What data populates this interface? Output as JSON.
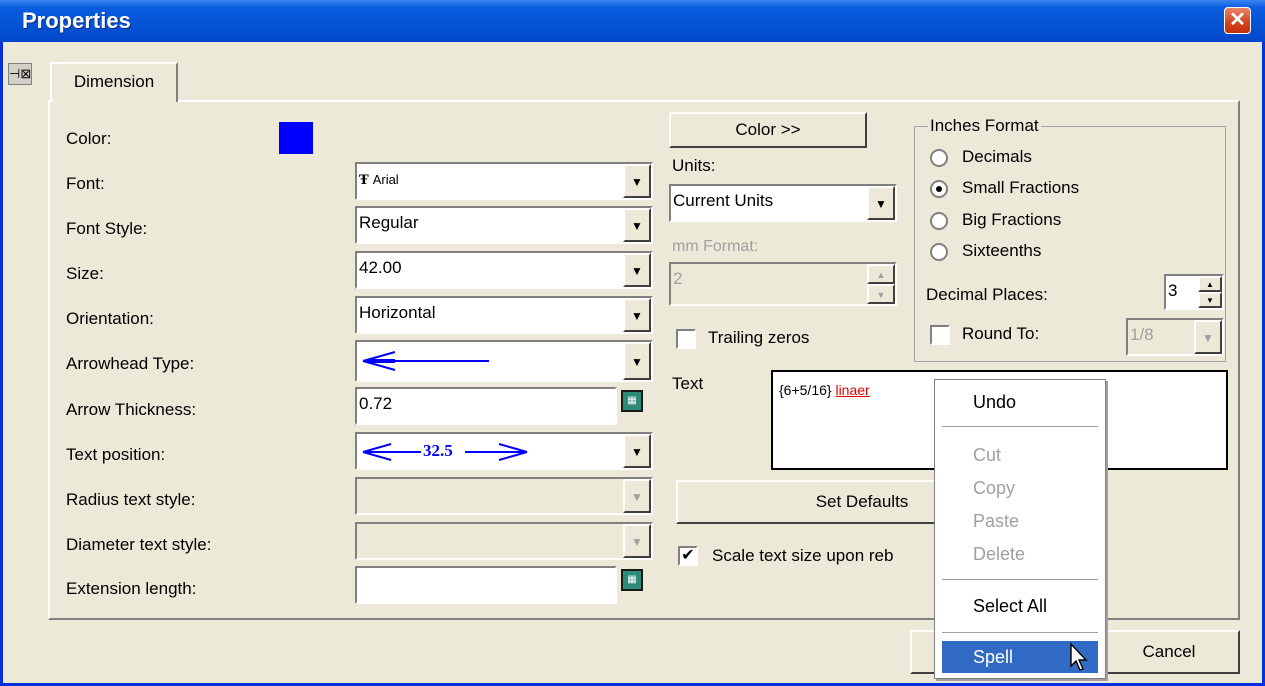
{
  "window": {
    "title": "Properties",
    "close_glyph": "✕",
    "pin_glyph": "⊣⊠"
  },
  "tabs": [
    {
      "label": "Dimension",
      "active": true
    }
  ],
  "left": {
    "color_label": "Color:",
    "color_swatch": "#0000ff",
    "font_label": "Font:",
    "font_value": "Arial",
    "font_icon": "TrueType-icon",
    "font_icon_glyph": "Ŧ",
    "font_style_label": "Font Style:",
    "font_style_value": "Regular",
    "size_label": "Size:",
    "size_value": "42.00",
    "orientation_label": "Orientation:",
    "orientation_value": "Horizontal",
    "arrowhead_label": "Arrowhead Type:",
    "arrow_thickness_label": "Arrow Thickness:",
    "arrow_thickness_value": "0.72",
    "text_position_label": "Text position:",
    "text_position_sample": "32.5",
    "radius_label": "Radius text style:",
    "diameter_label": "Diameter text style:",
    "extension_label": "Extension length:",
    "extension_value": ""
  },
  "middle": {
    "color_button": "Color >>",
    "units_label": "Units:",
    "units_value": "Current Units",
    "mm_format_label": "mm Format:",
    "mm_format_value": "2",
    "trailing_zeros_label": "Trailing zeros",
    "text_label": "Text",
    "text_value_plain": "{6+5/16}",
    "text_value_misspelled": "linaer",
    "set_defaults_button": "Set Defaults",
    "scale_text_label": "Scale text size upon reb",
    "scale_text_checked": true
  },
  "inches": {
    "group_title": "Inches Format",
    "options": [
      "Decimals",
      "Small Fractions",
      "Big Fractions",
      "Sixteenths"
    ],
    "selected": "Small Fractions",
    "decimal_places_label": "Decimal Places:",
    "decimal_places_value": "3",
    "round_to_label": "Round To:",
    "round_to_value": "1/8"
  },
  "footer": {
    "cancel_button": "Cancel"
  },
  "context_menu": {
    "undo": "Undo",
    "cut": "Cut",
    "copy": "Copy",
    "paste": "Paste",
    "delete": "Delete",
    "select_all": "Select All",
    "spell": "Spell"
  },
  "glyphs": {
    "dropdown": "▼",
    "spin_up": "▲",
    "spin_down": "▼",
    "check": "✔",
    "calc": "▦"
  },
  "colors": {
    "titlebar": "#0553d3",
    "selection": "#316ac5",
    "misspelled": "#e00000",
    "arrow_blue": "#0000ff"
  }
}
